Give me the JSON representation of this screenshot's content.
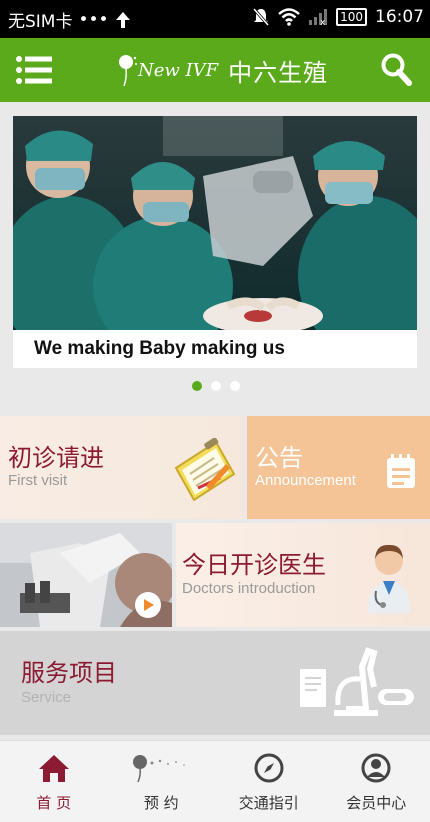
{
  "status_bar": {
    "carrier": "无SIM卡",
    "dots": "•••",
    "battery": "100",
    "time": "16:07"
  },
  "header": {
    "brand_en": "New IVF",
    "brand_cn": "中六生殖"
  },
  "banner": {
    "caption": "We making Baby making us",
    "slide_count": 3,
    "active_slide": 1
  },
  "tiles": {
    "first_visit": {
      "cn": "初诊请进",
      "en": "First visit"
    },
    "announcement": {
      "cn": "公告",
      "en": "Announcement"
    },
    "doctors": {
      "cn": "今日开诊医生",
      "en": "Doctors introduction"
    },
    "service": {
      "cn": "服务项目",
      "en": "Service"
    }
  },
  "tabs": [
    {
      "label": "首 页",
      "icon": "home-icon",
      "active": true
    },
    {
      "label": "预 约",
      "icon": "dandelion-icon",
      "active": false
    },
    {
      "label": "交通指引",
      "icon": "compass-icon",
      "active": false
    },
    {
      "label": "会员中心",
      "icon": "user-icon",
      "active": false
    }
  ],
  "colors": {
    "brand_green": "#5aaa1c",
    "accent_red": "#8b1a32",
    "announcement_orange": "#f4c497"
  }
}
